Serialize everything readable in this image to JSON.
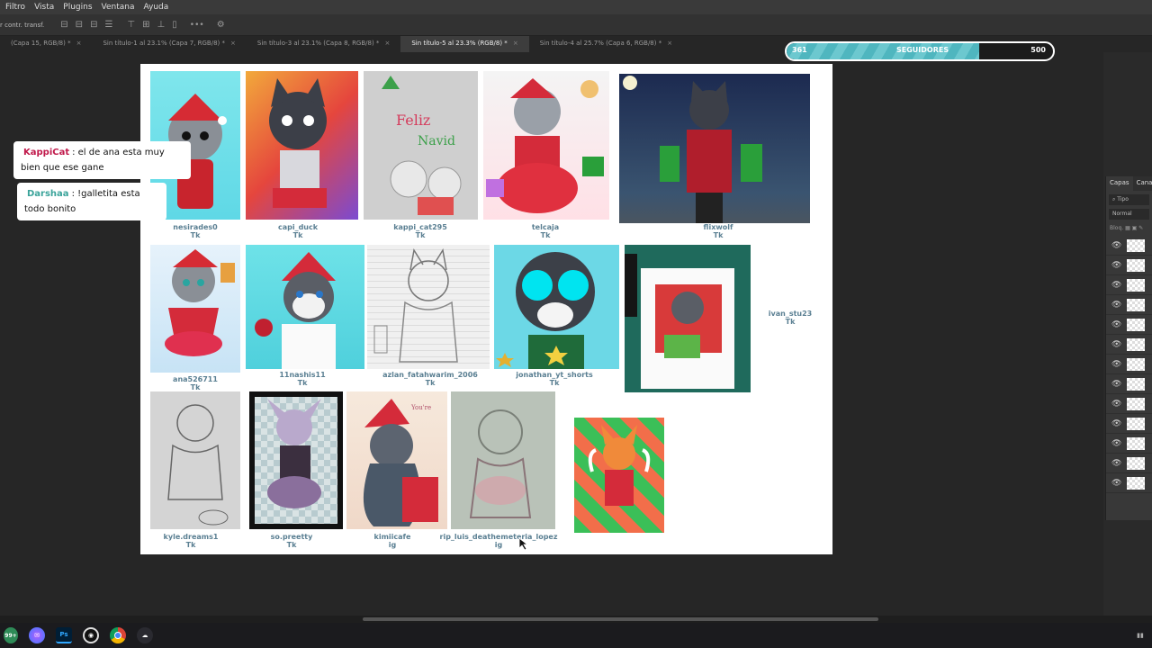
{
  "menu": [
    "Filtro",
    "Vista",
    "Plugins",
    "Ventana",
    "Ayuda"
  ],
  "options": {
    "transform_label": "r contr. transf.",
    "more_label": "•••"
  },
  "tabs": [
    {
      "label": "(Capa 15, RGB/8) *",
      "active": false
    },
    {
      "label": "Sin título-1 al 23.1% (Capa 7, RGB/8) *",
      "active": false
    },
    {
      "label": "Sin título-3 al 23.1% (Capa 8, RGB/8) *",
      "active": false
    },
    {
      "label": "Sin título-5 al 23.3% (RGB/8) *",
      "active": true
    },
    {
      "label": "Sin título-4 al 25.7% (Capa 6, RGB/8) *",
      "active": false
    }
  ],
  "followers": {
    "current": "361",
    "label": "SEGUIDORES",
    "goal": "500",
    "progress": 0.722,
    "accent": "#4fb6bf"
  },
  "chat": [
    {
      "user": "KappiCat",
      "message": ": el de ana esta muy bien que ese gane",
      "user_color": "#c0184a"
    },
    {
      "user": "Darshaa",
      "message": ": !galletita esta todo bonito",
      "user_color": "#3aa39a"
    }
  ],
  "artworks": [
    {
      "artist": "nesirades0",
      "platform": "Tk"
    },
    {
      "artist": "capi_duck",
      "platform": "Tk"
    },
    {
      "artist": "kappi_cat295",
      "platform": "Tk"
    },
    {
      "artist": "telcaja",
      "platform": "Tk"
    },
    {
      "artist": "flixwolf",
      "platform": "Tk"
    },
    {
      "artist": "ana526711",
      "platform": "Tk"
    },
    {
      "artist": "11nashis11",
      "platform": "Tk"
    },
    {
      "artist": "azlan_fatahwarim_2006",
      "platform": "Tk"
    },
    {
      "artist": "jonathan_yt_shorts",
      "platform": "Tk"
    },
    {
      "artist": "ivan_stu23",
      "platform": "Tk"
    },
    {
      "artist": "kyle.dreams1",
      "platform": "Tk"
    },
    {
      "artist": "so.preetty",
      "platform": "Tk"
    },
    {
      "artist": "kimiicafe",
      "platform": "ig"
    },
    {
      "artist": "rip_luis_deathemeteria_lopez",
      "platform": "ig"
    }
  ],
  "layers_panel": {
    "tabs": [
      "Capas",
      "Canal"
    ],
    "filter": "Tipo",
    "blend": "Normal",
    "lock": "Bloq."
  },
  "taskbar": [
    "99+",
    "Ps"
  ]
}
